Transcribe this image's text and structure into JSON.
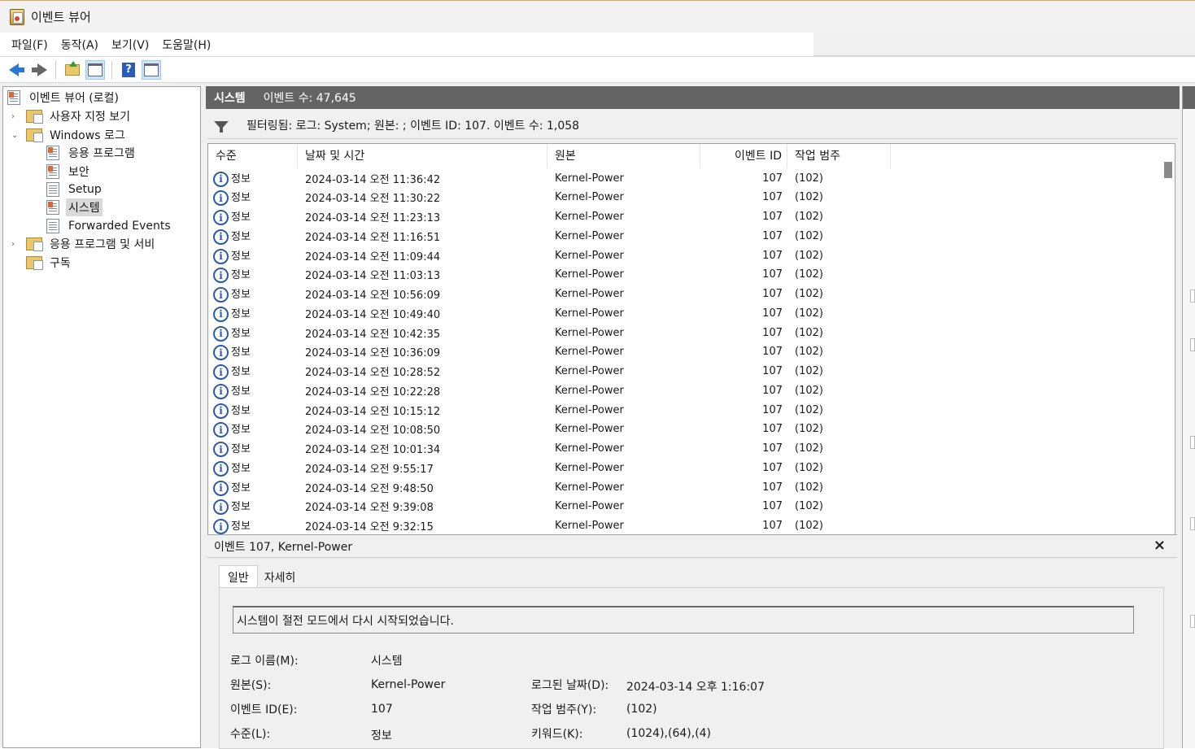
{
  "window": {
    "title": "이벤트 뷰어"
  },
  "menu": {
    "file": "파일(F)",
    "action": "동작(A)",
    "view": "보기(V)",
    "help": "도움말(H)"
  },
  "tree": {
    "root": "이벤트 뷰어 (로컬)",
    "custom_views": "사용자 지정 보기",
    "windows_logs": "Windows 로그",
    "application": "응용 프로그램",
    "security": "보안",
    "setup": "Setup",
    "system": "시스템",
    "forwarded": "Forwarded Events",
    "apps_services": "응용 프로그램 및 서비",
    "subscriptions": "구독"
  },
  "header": {
    "title": "시스템",
    "count": "이벤트 수: 47,645"
  },
  "filter": {
    "text": "필터링됨: 로그: System; 원본: ; 이벤트 ID: 107. 이벤트 수: 1,058"
  },
  "columns": {
    "level": "수준",
    "datetime": "날짜 및 시간",
    "source": "원본",
    "event_id": "이벤트 ID",
    "category": "작업 범주"
  },
  "events": [
    {
      "level": "정보",
      "datetime": "2024-03-14 오전 11:36:42",
      "source": "Kernel-Power",
      "event_id": "107",
      "category": "(102)"
    },
    {
      "level": "정보",
      "datetime": "2024-03-14 오전 11:30:22",
      "source": "Kernel-Power",
      "event_id": "107",
      "category": "(102)"
    },
    {
      "level": "정보",
      "datetime": "2024-03-14 오전 11:23:13",
      "source": "Kernel-Power",
      "event_id": "107",
      "category": "(102)"
    },
    {
      "level": "정보",
      "datetime": "2024-03-14 오전 11:16:51",
      "source": "Kernel-Power",
      "event_id": "107",
      "category": "(102)"
    },
    {
      "level": "정보",
      "datetime": "2024-03-14 오전 11:09:44",
      "source": "Kernel-Power",
      "event_id": "107",
      "category": "(102)"
    },
    {
      "level": "정보",
      "datetime": "2024-03-14 오전 11:03:13",
      "source": "Kernel-Power",
      "event_id": "107",
      "category": "(102)"
    },
    {
      "level": "정보",
      "datetime": "2024-03-14 오전 10:56:09",
      "source": "Kernel-Power",
      "event_id": "107",
      "category": "(102)"
    },
    {
      "level": "정보",
      "datetime": "2024-03-14 오전 10:49:40",
      "source": "Kernel-Power",
      "event_id": "107",
      "category": "(102)"
    },
    {
      "level": "정보",
      "datetime": "2024-03-14 오전 10:42:35",
      "source": "Kernel-Power",
      "event_id": "107",
      "category": "(102)"
    },
    {
      "level": "정보",
      "datetime": "2024-03-14 오전 10:36:09",
      "source": "Kernel-Power",
      "event_id": "107",
      "category": "(102)"
    },
    {
      "level": "정보",
      "datetime": "2024-03-14 오전 10:28:52",
      "source": "Kernel-Power",
      "event_id": "107",
      "category": "(102)"
    },
    {
      "level": "정보",
      "datetime": "2024-03-14 오전 10:22:28",
      "source": "Kernel-Power",
      "event_id": "107",
      "category": "(102)"
    },
    {
      "level": "정보",
      "datetime": "2024-03-14 오전 10:15:12",
      "source": "Kernel-Power",
      "event_id": "107",
      "category": "(102)"
    },
    {
      "level": "정보",
      "datetime": "2024-03-14 오전 10:08:50",
      "source": "Kernel-Power",
      "event_id": "107",
      "category": "(102)"
    },
    {
      "level": "정보",
      "datetime": "2024-03-14 오전 10:01:34",
      "source": "Kernel-Power",
      "event_id": "107",
      "category": "(102)"
    },
    {
      "level": "정보",
      "datetime": "2024-03-14 오전 9:55:17",
      "source": "Kernel-Power",
      "event_id": "107",
      "category": "(102)"
    },
    {
      "level": "정보",
      "datetime": "2024-03-14 오전 9:48:50",
      "source": "Kernel-Power",
      "event_id": "107",
      "category": "(102)"
    },
    {
      "level": "정보",
      "datetime": "2024-03-14 오전 9:39:08",
      "source": "Kernel-Power",
      "event_id": "107",
      "category": "(102)"
    },
    {
      "level": "정보",
      "datetime": "2024-03-14 오전 9:32:15",
      "source": "Kernel-Power",
      "event_id": "107",
      "category": "(102)"
    }
  ],
  "detail": {
    "title": "이벤트 107, Kernel-Power",
    "close": "×",
    "tab_general": "일반",
    "tab_details": "자세히",
    "message": "시스템이 절전 모드에서 다시 시작되었습니다.",
    "log_name_label": "로그 이름(M):",
    "log_name": "시스템",
    "source_label": "원본(S):",
    "source": "Kernel-Power",
    "logged_label": "로그된 날짜(D):",
    "logged": "2024-03-14 오후 1:16:07",
    "event_id_label": "이벤트 ID(E):",
    "event_id": "107",
    "category_label": "작업 범주(Y):",
    "category": "(102)",
    "level_label": "수준(L):",
    "level": "정보",
    "keywords_label": "키워드(K):",
    "keywords": "(1024),(64),(4)"
  },
  "colors": {
    "header_bg": "#646464",
    "info_icon": "#2d5aa8",
    "selection": "#cfe3f7"
  }
}
